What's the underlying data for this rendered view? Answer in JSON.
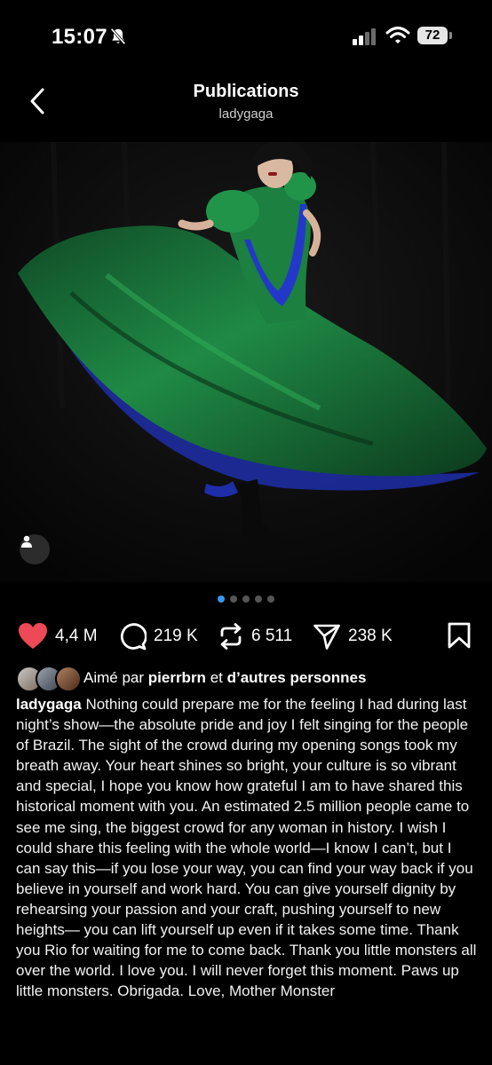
{
  "status_bar": {
    "time": "15:07",
    "battery": "72",
    "icons": [
      "bell-slash-icon",
      "signal-icon",
      "wifi-icon",
      "battery-icon"
    ]
  },
  "nav": {
    "title": "Publications",
    "subtitle": "ladygaga",
    "back_icon": "chevron-left-icon"
  },
  "carousel": {
    "total": 5,
    "active_index": 0
  },
  "actions": {
    "likes": "4,4 M",
    "comments": "219 K",
    "reposts": "6 511",
    "shares": "238 K",
    "like_color": "#ed4956",
    "icons": [
      "heart-icon",
      "comment-icon",
      "repost-icon",
      "share-icon",
      "bookmark-icon"
    ]
  },
  "liked_by": {
    "prefix": "Aimé par",
    "user": "pierrbrn",
    "connector": "et",
    "others": "d’autres personnes"
  },
  "caption": {
    "username": "ladygaga",
    "text": "Nothing could prepare me for the feeling I had during last night’s show—the absolute pride and joy I felt singing for the people of Brazil. The sight of the crowd during my opening songs took my breath away. Your heart shines so bright, your culture is so vibrant and special, I hope you know how grateful I am to have shared this historical moment with you.  An estimated 2.5 million people came to see me sing, the biggest crowd for any woman in history.  I wish I could share this feeling with the whole world—I know I can’t, but I can say this—if you lose your way, you can find your way back if you believe in yourself and work hard.  You can give yourself dignity by rehearsing your passion and your craft, pushing yourself to new heights— you can lift yourself up even if it takes some time.  Thank you Rio for waiting for me to come back.  Thank you little monsters all over the world. I love you. I will never forget this moment. Paws up little monsters. Obrigada. Love, Mother Monster"
  }
}
